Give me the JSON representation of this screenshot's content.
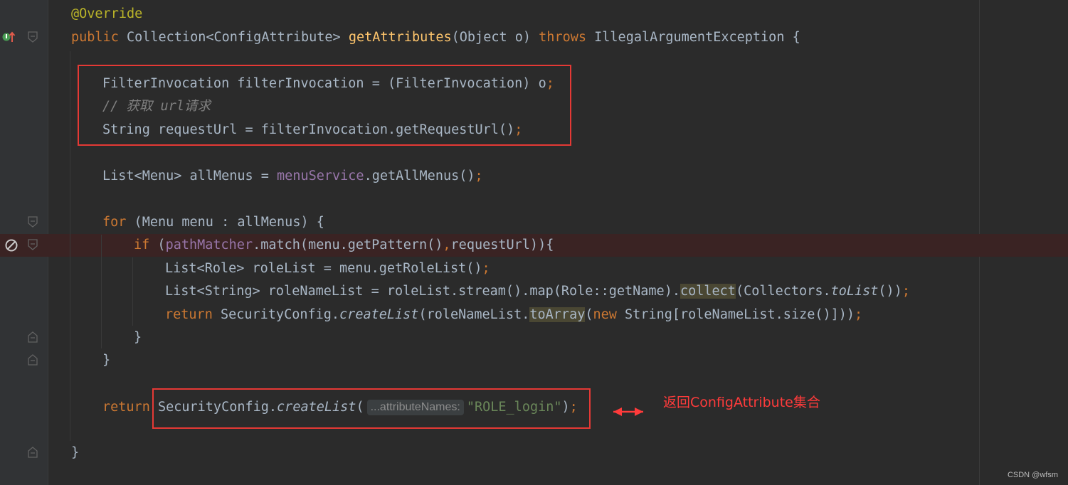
{
  "code": {
    "annotation": "@Override",
    "l1": {
      "kw_public": "public",
      "ret_type": "Collection<ConfigAttribute>",
      "method": "getAttributes",
      "params": "(Object o)",
      "kw_throws": "throws",
      "exception": "IllegalArgumentException {"
    },
    "l2": {
      "text": "FilterInvocation filterInvocation = (FilterInvocation) o",
      "semi": ";"
    },
    "l3": {
      "comment": "// 获取 url请求"
    },
    "l4": {
      "text": "String requestUrl = filterInvocation.getRequestUrl()",
      "semi": ";"
    },
    "l5": {
      "pre": "List<Menu> allMenus = ",
      "field": "menuService",
      "post": ".getAllMenus()",
      "semi": ";"
    },
    "l6": {
      "kw_for": "for",
      "rest": " (Menu menu : allMenus) {"
    },
    "l7": {
      "kw_if": "if",
      "paren": " (",
      "field": "pathMatcher",
      "mid": ".match(menu.getPattern()",
      "comma": ",",
      "post": "requestUrl)){"
    },
    "l8": {
      "text": "List<Role> roleList = menu.getRoleList()",
      "semi": ";"
    },
    "l9": {
      "pre": "List<String> roleNameList = roleList.stream().map(Role::getName).",
      "collect": "collect",
      "mid": "(Collectors.",
      "tolist": "toList",
      "post": "())",
      "semi": ";"
    },
    "l10": {
      "kw_return": "return",
      "pre": " SecurityConfig.",
      "create": "createList",
      "mid": "(roleNameList.",
      "toarray": "toArray",
      "paren": "(",
      "kw_new": "new",
      "post": " String[roleNameList.size()]))",
      "semi": ";"
    },
    "l11": {
      "brace": "}"
    },
    "l12": {
      "brace": "}"
    },
    "l13": {
      "kw_return": "return",
      "pre": " SecurityConfig.",
      "create": "createList",
      "paren": "(",
      "hint": "...attributeNames:",
      "str": "\"ROLE_login\"",
      "close": ")",
      "semi": ";"
    },
    "l14": {
      "brace": "}"
    }
  },
  "annotation_note": "返回ConfigAttribute集合",
  "watermark": "CSDN @wfsm",
  "colors": {
    "keyword": "#cc7832",
    "string": "#6a8759",
    "method": "#ffc66d",
    "field": "#9876aa",
    "highlight_box": "#e53935"
  }
}
